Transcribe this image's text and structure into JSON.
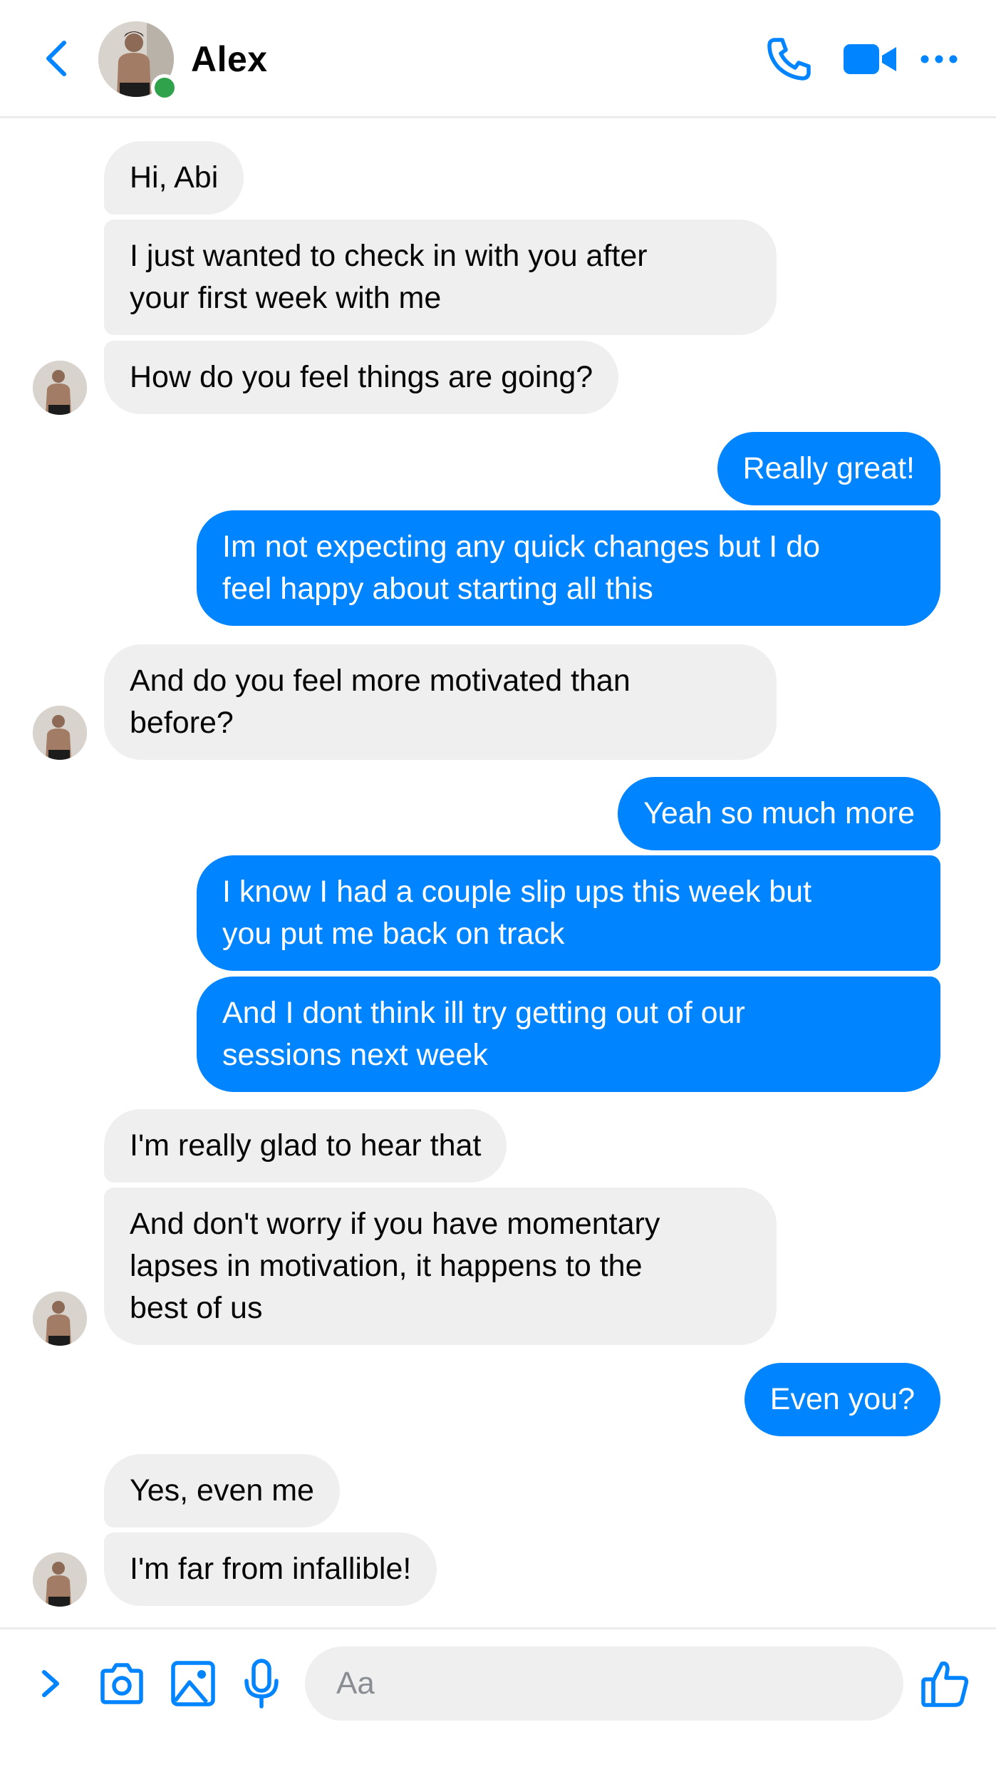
{
  "header": {
    "contact_name": "Alex",
    "status": "online",
    "icons": [
      "back-chevron-icon",
      "phone-icon",
      "video-camera-icon",
      "more-options-icon"
    ]
  },
  "colors": {
    "accent": "#0084ff",
    "incoming_bubble": "#efefef",
    "online": "#31a24c"
  },
  "messages": [
    {
      "direction": "incoming",
      "text": "Hi, Abi"
    },
    {
      "direction": "incoming",
      "text": "I just wanted to check in with you after\nyour first week with me"
    },
    {
      "direction": "incoming",
      "text": "How do you feel things are going?"
    },
    {
      "direction": "outgoing",
      "text": "Really great!"
    },
    {
      "direction": "outgoing",
      "text": "Im not expecting any quick changes but I do\nfeel happy about starting all this"
    },
    {
      "direction": "incoming",
      "text": "And do you feel more motivated than\nbefore?"
    },
    {
      "direction": "outgoing",
      "text": "Yeah so much more"
    },
    {
      "direction": "outgoing",
      "text": "I know I had a couple slip ups this week but\nyou put me back on track"
    },
    {
      "direction": "outgoing",
      "text": "And I dont think ill try getting out of our\nsessions next week"
    },
    {
      "direction": "incoming",
      "text": "I'm really glad to hear that"
    },
    {
      "direction": "incoming",
      "text": "And don't worry if you have momentary\nlapses in motivation, it happens to the\nbest of us"
    },
    {
      "direction": "outgoing",
      "text": "Even you?"
    },
    {
      "direction": "incoming",
      "text": "Yes, even me"
    },
    {
      "direction": "incoming",
      "text": "I'm far from infallible!"
    }
  ],
  "composer": {
    "placeholder": "Aa",
    "icons": [
      "expand-chevron-icon",
      "camera-icon",
      "image-icon",
      "microphone-icon",
      "thumbs-up-icon"
    ]
  }
}
